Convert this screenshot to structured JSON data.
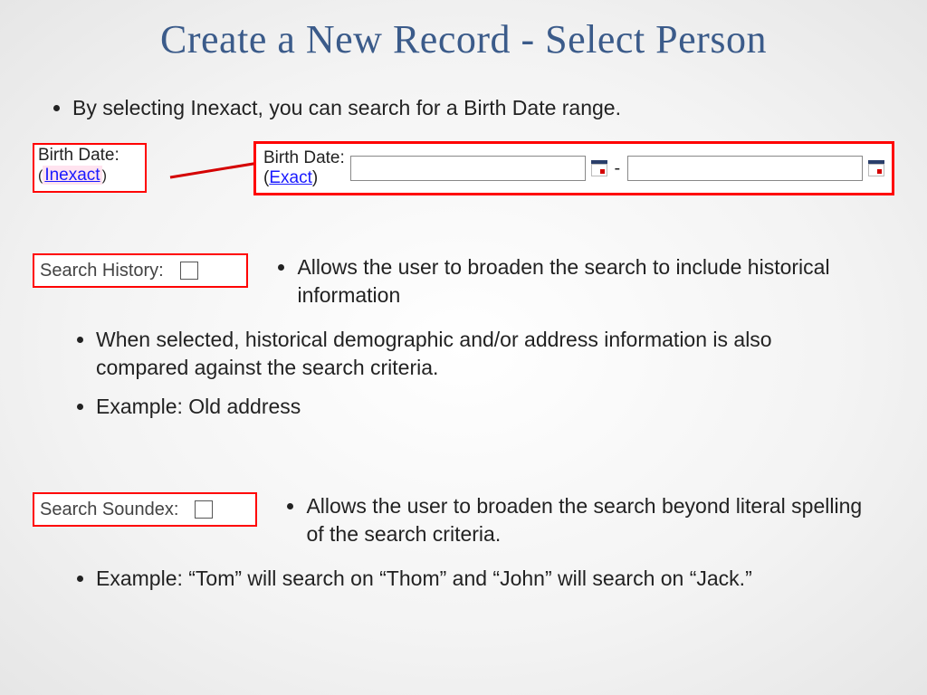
{
  "title": "Create a New Record - Select Person",
  "intro_bullet": "By selecting Inexact, you can search for a Birth Date range.",
  "birthdate": {
    "label": "Birth Date:",
    "inexact_link": "Inexact",
    "exact_link": "Exact",
    "range_separator": "-"
  },
  "history": {
    "label": "Search History:",
    "right_bullet": "Allows the user to broaden the search to include historical information",
    "bullets": [
      "When selected, historical demographic and/or address information is also compared against the search criteria.",
      "Example:  Old address"
    ]
  },
  "soundex": {
    "label": "Search Soundex:",
    "right_bullet": "Allows the user to broaden the search beyond literal spelling of the search criteria.",
    "bullets": [
      "Example: “Tom” will search on “Thom” and “John” will search on “Jack.”"
    ]
  }
}
